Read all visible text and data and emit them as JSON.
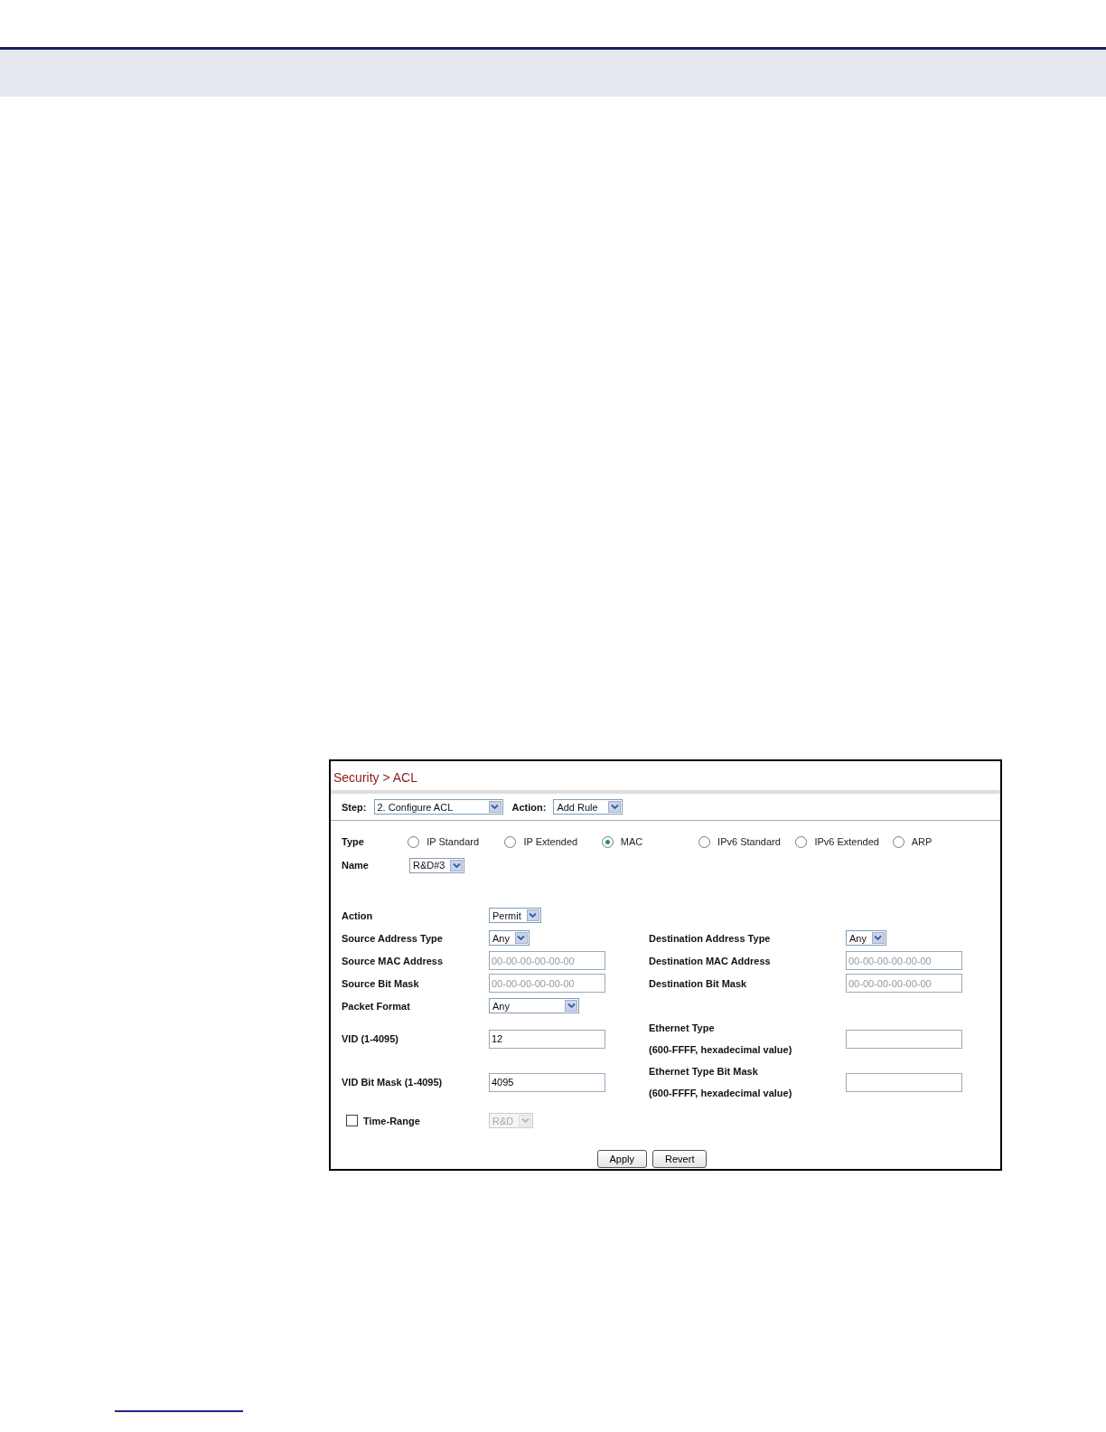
{
  "screen": {
    "title": "Security > ACL",
    "toolbar": [
      {
        "label": "Step:",
        "value": "2. Configure ACL"
      },
      {
        "label": "Action:",
        "value": "Add Rule"
      }
    ],
    "type": {
      "label": "Type",
      "options": [
        {
          "label": "IP Standard",
          "selected": false
        },
        {
          "label": "IP Extended",
          "selected": false
        },
        {
          "label": "MAC",
          "selected": true
        },
        {
          "label": "IPv6 Standard",
          "selected": false
        },
        {
          "label": "IPv6 Extended",
          "selected": false
        },
        {
          "label": "ARP",
          "selected": false
        }
      ]
    },
    "name": {
      "label": "Name",
      "value": "R&D#3"
    },
    "rows": [
      {
        "left": {
          "label": "Action",
          "kind": "select",
          "value": "Permit"
        }
      },
      {
        "left": {
          "label": "Source Address Type",
          "kind": "select",
          "value": "Any"
        },
        "right": {
          "label": "Destination Address Type",
          "kind": "select",
          "value": "Any"
        }
      },
      {
        "left": {
          "label": "Source MAC Address",
          "kind": "input",
          "placeholder": "00-00-00-00-00-00"
        },
        "right": {
          "label": "Destination MAC Address",
          "kind": "input",
          "placeholder": "00-00-00-00-00-00"
        }
      },
      {
        "left": {
          "label": "Source Bit Mask",
          "kind": "input",
          "placeholder": "00-00-00-00-00-00"
        },
        "right": {
          "label": "Destination Bit Mask",
          "kind": "input",
          "placeholder": "00-00-00-00-00-00"
        }
      },
      {
        "left": {
          "label": "Packet Format",
          "kind": "wide-select",
          "value": "Any"
        }
      },
      {
        "left": {
          "label": "VID (1-4095)",
          "kind": "input",
          "value": "12"
        },
        "right": {
          "label": "Ethernet Type",
          "note": "(600-FFFF, hexadecimal value)",
          "kind": "input"
        }
      },
      {
        "left": {
          "label": "VID Bit Mask (1-4095)",
          "kind": "input",
          "value": "4095"
        },
        "right": {
          "label": "Ethernet Type Bit Mask",
          "note": "(600-FFFF, hexadecimal value)",
          "kind": "input"
        }
      },
      {
        "left": {
          "label": "Time-Range",
          "kind": "checkbox",
          "checked": false,
          "value": "R&D",
          "disabled": true
        }
      }
    ],
    "buttons": [
      "Apply",
      "Revert"
    ]
  }
}
